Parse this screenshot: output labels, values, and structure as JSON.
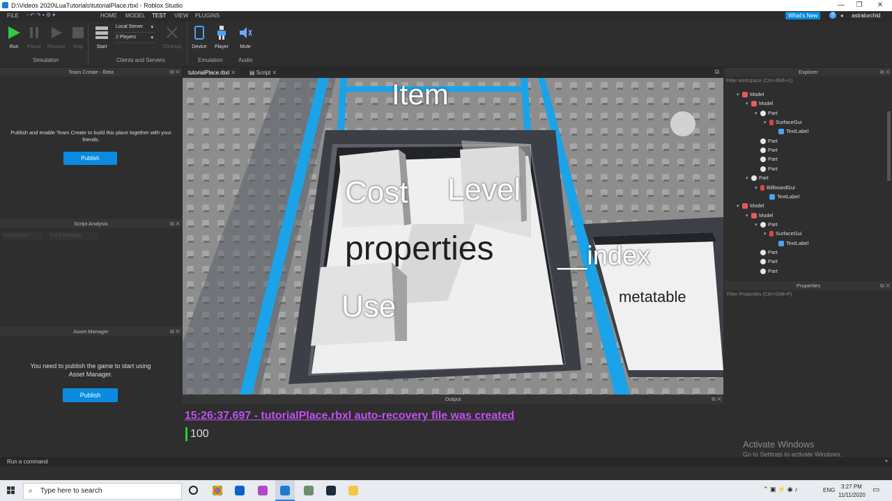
{
  "window": {
    "title": "D:\\Videos 2020\\LuaTutorials\\tutorialPlace.rbxl - Roblox Studio",
    "controls": [
      "—",
      "❐",
      "✕"
    ]
  },
  "menu": {
    "file": "FILE",
    "tabs": [
      "HOME",
      "MODEL",
      "TEST",
      "VIEW",
      "PLUGINS"
    ],
    "whats_new": "What's New",
    "help": "?",
    "user": "astralorchid"
  },
  "ribbon": {
    "run": "Run",
    "pause": "Pause",
    "resume": "Resume",
    "stop": "Stop",
    "simulation_label": "Simulation",
    "start": "Start",
    "server_select": "Local Server",
    "players_select": "2 Players",
    "cleanup": "Cleanup",
    "clients_label": "Clients and Servers",
    "device": "Device",
    "player": "Player",
    "emulation_label": "Emulation",
    "mute": "Mute",
    "audio_label": "Audio"
  },
  "team_create": {
    "title": "Team Create - Beta",
    "message": "Publish and enable Team Create to build this place together with your friends.",
    "button": "Publish"
  },
  "script_analysis": {
    "title": "Script Analysis",
    "errors": "0 of 0 Errors",
    "warnings": "0 of 0 Warnings"
  },
  "asset_manager": {
    "title": "Asset Manager",
    "message": "You need to publish the game to start using Asset Manager.",
    "button": "Publish"
  },
  "doc_tabs": {
    "place": "tutorialPlace.rbxl",
    "script": "Script"
  },
  "viewport_labels": {
    "item": "Item",
    "cost": "Cost",
    "level": "Level",
    "properties": "properties",
    "use": "Use",
    "index": "__index",
    "metatable": "metatable"
  },
  "output": {
    "title": "Output",
    "line1": "15:26:37.697 - tutorialPlace.rbxl auto-recovery file was created",
    "line2": "100"
  },
  "explorer": {
    "title": "Explorer",
    "filter": "Filter workspace (Ctrl+Shift+X)",
    "rows": [
      {
        "label": "Model",
        "icon": "model",
        "indent": 1,
        "chev": "▾"
      },
      {
        "label": "Model",
        "icon": "model",
        "indent": 2,
        "chev": "▾"
      },
      {
        "label": "Part",
        "icon": "part",
        "indent": 3,
        "chev": "▾"
      },
      {
        "label": "SurfaceGui",
        "icon": "gui",
        "indent": 4,
        "chev": "▾"
      },
      {
        "label": "TextLabel",
        "icon": "text",
        "indent": 5,
        "chev": ""
      },
      {
        "label": "Part",
        "icon": "part",
        "indent": 3,
        "chev": ""
      },
      {
        "label": "Part",
        "icon": "part",
        "indent": 3,
        "chev": ""
      },
      {
        "label": "Part",
        "icon": "part",
        "indent": 3,
        "chev": ""
      },
      {
        "label": "Part",
        "icon": "part",
        "indent": 3,
        "chev": ""
      },
      {
        "label": "Part",
        "icon": "part",
        "indent": 2,
        "chev": "▾"
      },
      {
        "label": "BillboardGui",
        "icon": "gui",
        "indent": 3,
        "chev": "▾"
      },
      {
        "label": "TextLabel",
        "icon": "text",
        "indent": 4,
        "chev": ""
      },
      {
        "label": "Model",
        "icon": "model",
        "indent": 1,
        "chev": "▾"
      },
      {
        "label": "Model",
        "icon": "model",
        "indent": 2,
        "chev": "▾"
      },
      {
        "label": "Part",
        "icon": "part",
        "indent": 3,
        "chev": "▾"
      },
      {
        "label": "SurfaceGui",
        "icon": "gui",
        "indent": 4,
        "chev": "▾"
      },
      {
        "label": "TextLabel",
        "icon": "text",
        "indent": 5,
        "chev": ""
      },
      {
        "label": "Part",
        "icon": "part",
        "indent": 3,
        "chev": ""
      },
      {
        "label": "Part",
        "icon": "part",
        "indent": 3,
        "chev": ""
      },
      {
        "label": "Part",
        "icon": "part",
        "indent": 3,
        "chev": ""
      }
    ]
  },
  "properties": {
    "title": "Properties",
    "filter": "Filter Properties (Ctrl+Shift+P)"
  },
  "watermark": {
    "line1": "Activate Windows",
    "line2": "Go to Settings to activate Windows."
  },
  "command_bar": {
    "placeholder": "Run a command"
  },
  "taskbar": {
    "search_placeholder": "Type here to search",
    "lang": "ENG",
    "time": "3:27 PM",
    "date": "11/11/2020"
  },
  "colors": {
    "accent_blue": "#0a8be0",
    "output_purple": "#c150f0",
    "stud_floor": "#8f8f8f",
    "path_blue": "#1aa3e8"
  }
}
